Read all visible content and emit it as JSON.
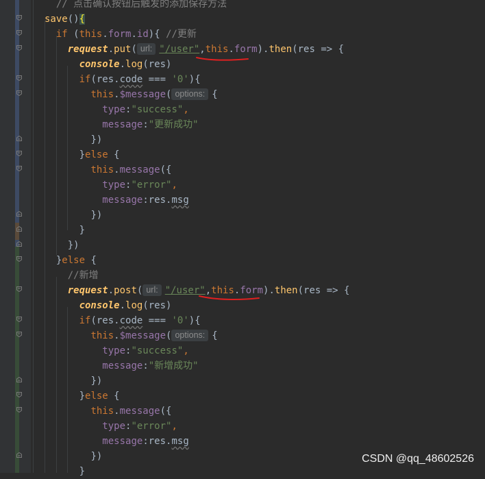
{
  "code": {
    "lines": [
      [
        [
          "cm",
          "  // 点击确认按钮后触发的添加保存方法"
        ]
      ],
      [
        [
          "fn",
          "save"
        ],
        [
          "plain",
          "()"
        ],
        [
          "brace",
          "{"
        ]
      ],
      [
        [
          "ws",
          "  "
        ],
        [
          "kw",
          "if "
        ],
        [
          "plain",
          "("
        ],
        [
          "kw",
          "this"
        ],
        [
          "plain",
          "."
        ],
        [
          "pp",
          "form"
        ],
        [
          "plain",
          "."
        ],
        [
          "pp",
          "id"
        ],
        [
          "plain",
          ")"
        ],
        [
          "plain",
          "{ "
        ],
        [
          "cm",
          "//更新"
        ]
      ],
      [
        [
          "ws",
          "    "
        ],
        [
          "fi",
          "request"
        ],
        [
          "plain",
          "."
        ],
        [
          "mt",
          "put"
        ],
        [
          "plain",
          "("
        ],
        [
          "hint",
          "url:"
        ],
        [
          "su",
          "\"/user\""
        ],
        [
          "plain",
          ","
        ],
        [
          "kw",
          "this"
        ],
        [
          "plain",
          "."
        ],
        [
          "pp",
          "form"
        ],
        [
          "plain",
          ")."
        ],
        [
          "mt",
          "then"
        ],
        [
          "plain",
          "(res => {"
        ]
      ],
      [
        [
          "ws",
          "      "
        ],
        [
          "fi",
          "console"
        ],
        [
          "plain",
          "."
        ],
        [
          "mt",
          "log"
        ],
        [
          "plain",
          "(res)"
        ]
      ],
      [
        [
          "ws",
          "      "
        ],
        [
          "kw",
          "if"
        ],
        [
          "plain",
          "(res."
        ],
        [
          "wavy",
          "code"
        ],
        [
          "plain",
          " === "
        ],
        [
          "st",
          "'0'"
        ],
        [
          "plain",
          "){"
        ]
      ],
      [
        [
          "ws",
          "        "
        ],
        [
          "kw",
          "this"
        ],
        [
          "plain",
          "."
        ],
        [
          "pp",
          "$message"
        ],
        [
          "plain",
          "("
        ],
        [
          "hint",
          "options:"
        ],
        [
          "plain",
          "{"
        ]
      ],
      [
        [
          "ws",
          "          "
        ],
        [
          "pp",
          "type"
        ],
        [
          "plain",
          ":"
        ],
        [
          "st",
          "\"success\""
        ],
        [
          "kw",
          ","
        ]
      ],
      [
        [
          "ws",
          "          "
        ],
        [
          "pp",
          "message"
        ],
        [
          "plain",
          ":"
        ],
        [
          "st",
          "\"更新成功\""
        ]
      ],
      [
        [
          "ws",
          "        "
        ],
        [
          "plain",
          "})"
        ]
      ],
      [
        [
          "ws",
          "      "
        ],
        [
          "plain",
          "}"
        ],
        [
          "kw",
          "else "
        ],
        [
          "plain",
          "{"
        ]
      ],
      [
        [
          "ws",
          "        "
        ],
        [
          "kw",
          "this"
        ],
        [
          "plain",
          "."
        ],
        [
          "pp",
          "message"
        ],
        [
          "plain",
          "({"
        ]
      ],
      [
        [
          "ws",
          "          "
        ],
        [
          "pp",
          "type"
        ],
        [
          "plain",
          ":"
        ],
        [
          "st",
          "\"error\""
        ],
        [
          "kw",
          ","
        ]
      ],
      [
        [
          "ws",
          "          "
        ],
        [
          "pp",
          "message"
        ],
        [
          "plain",
          ":res."
        ],
        [
          "wavy",
          "msg"
        ]
      ],
      [
        [
          "ws",
          "        "
        ],
        [
          "plain",
          "})"
        ]
      ],
      [
        [
          "ws",
          "      "
        ],
        [
          "plain",
          "}"
        ]
      ],
      [
        [
          "ws",
          "    "
        ],
        [
          "plain",
          "})"
        ]
      ],
      [
        [
          "ws",
          "  "
        ],
        [
          "plain",
          "}"
        ],
        [
          "kw",
          "else "
        ],
        [
          "plain",
          "{"
        ]
      ],
      [
        [
          "ws",
          "    "
        ],
        [
          "cm",
          "//新增"
        ]
      ],
      [
        [
          "ws",
          "    "
        ],
        [
          "fi",
          "request"
        ],
        [
          "plain",
          "."
        ],
        [
          "mt",
          "post"
        ],
        [
          "plain",
          "("
        ],
        [
          "hint",
          "url:"
        ],
        [
          "su",
          "\"/user\""
        ],
        [
          "plain",
          ","
        ],
        [
          "kw",
          "this"
        ],
        [
          "plain",
          "."
        ],
        [
          "pp",
          "form"
        ],
        [
          "plain",
          ")."
        ],
        [
          "mt",
          "then"
        ],
        [
          "plain",
          "(res => {"
        ]
      ],
      [
        [
          "ws",
          "      "
        ],
        [
          "fi",
          "console"
        ],
        [
          "plain",
          "."
        ],
        [
          "mt",
          "log"
        ],
        [
          "plain",
          "(res)"
        ]
      ],
      [
        [
          "ws",
          "      "
        ],
        [
          "kw",
          "if"
        ],
        [
          "plain",
          "(res."
        ],
        [
          "wavy",
          "code"
        ],
        [
          "plain",
          " === "
        ],
        [
          "st",
          "'0'"
        ],
        [
          "plain",
          "){"
        ]
      ],
      [
        [
          "ws",
          "        "
        ],
        [
          "kw",
          "this"
        ],
        [
          "plain",
          "."
        ],
        [
          "pp",
          "$message"
        ],
        [
          "plain",
          "("
        ],
        [
          "hint",
          "options:"
        ],
        [
          "plain",
          "{"
        ]
      ],
      [
        [
          "ws",
          "          "
        ],
        [
          "pp",
          "type"
        ],
        [
          "plain",
          ":"
        ],
        [
          "st",
          "\"success\""
        ],
        [
          "kw",
          ","
        ]
      ],
      [
        [
          "ws",
          "          "
        ],
        [
          "pp",
          "message"
        ],
        [
          "plain",
          ":"
        ],
        [
          "st",
          "\"新增成功\""
        ]
      ],
      [
        [
          "ws",
          "        "
        ],
        [
          "plain",
          "})"
        ]
      ],
      [
        [
          "ws",
          "      "
        ],
        [
          "plain",
          "}"
        ],
        [
          "kw",
          "else "
        ],
        [
          "plain",
          "{"
        ]
      ],
      [
        [
          "ws",
          "        "
        ],
        [
          "kw",
          "this"
        ],
        [
          "plain",
          "."
        ],
        [
          "pp",
          "message"
        ],
        [
          "plain",
          "({"
        ]
      ],
      [
        [
          "ws",
          "          "
        ],
        [
          "pp",
          "type"
        ],
        [
          "plain",
          ":"
        ],
        [
          "st",
          "\"error\""
        ],
        [
          "kw",
          ","
        ]
      ],
      [
        [
          "ws",
          "          "
        ],
        [
          "pp",
          "message"
        ],
        [
          "plain",
          ":res."
        ],
        [
          "wavy",
          "msg"
        ]
      ],
      [
        [
          "ws",
          "        "
        ],
        [
          "plain",
          "})"
        ]
      ],
      [
        [
          "ws",
          "      "
        ],
        [
          "plain",
          "}"
        ]
      ]
    ]
  },
  "watermark": "CSDN @qq_48602526",
  "colors": {
    "background": "#2b2b2b",
    "keyword": "#cc7832",
    "string": "#6a8759",
    "property": "#9876aa",
    "function": "#ffc66d",
    "comment": "#808080",
    "text": "#a9b7c6",
    "annotation_red": "#e02020"
  },
  "icons": [
    "fold-marker-icon",
    "change-bar-icon"
  ]
}
